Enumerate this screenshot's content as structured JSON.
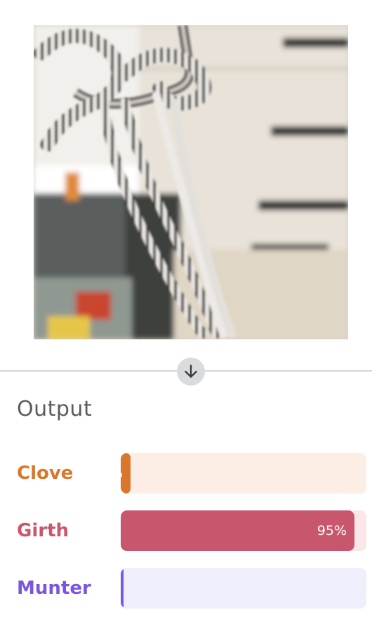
{
  "output": {
    "title": "Output",
    "results": [
      {
        "label": "Clove",
        "percent": 4,
        "percent_text": "4%",
        "color": "#d9782d",
        "track": "#fdeee5"
      },
      {
        "label": "Girth",
        "percent": 95,
        "percent_text": "95%",
        "color": "#c8566c",
        "track": "#fbe6ea"
      },
      {
        "label": "Munter",
        "percent": 1,
        "percent_text": "1%",
        "color": "#7a55e0",
        "track": "#efeefd"
      }
    ]
  },
  "icons": {
    "arrow": "arrow-down-icon"
  }
}
